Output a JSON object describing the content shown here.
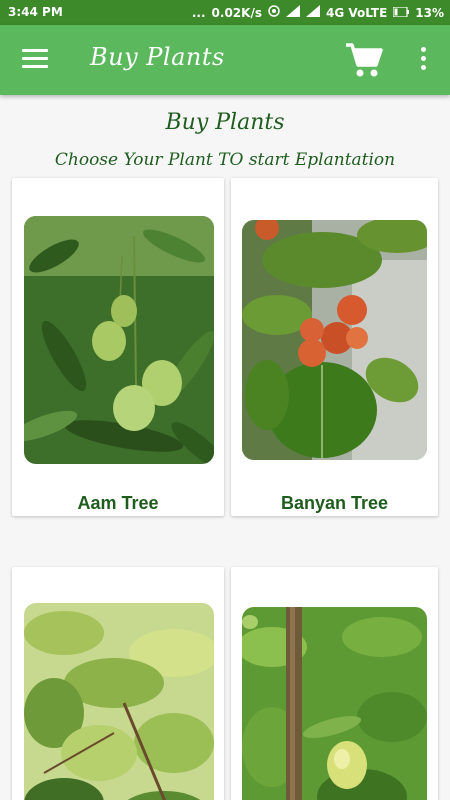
{
  "status_bar": {
    "time": "3:44 PM",
    "dots": "...",
    "speed": "0.02K/s",
    "network": "4G VoLTE",
    "battery": "13%"
  },
  "app_bar": {
    "title": "Buy Plants",
    "menu_icon": "hamburger-menu-icon",
    "cart_icon": "shopping-cart-icon",
    "more_icon": "more-vertical-icon"
  },
  "header": {
    "title": "Buy Plants",
    "subtitle": "Choose Your Plant TO start Eplantation"
  },
  "plants": [
    {
      "name": "Aam Tree"
    },
    {
      "name": "Banyan Tree"
    },
    {
      "name": ""
    },
    {
      "name": ""
    }
  ],
  "colors": {
    "status_bar": "#3c8a2a",
    "app_bar": "#5cb85c",
    "text_green": "#1f5d1f"
  }
}
